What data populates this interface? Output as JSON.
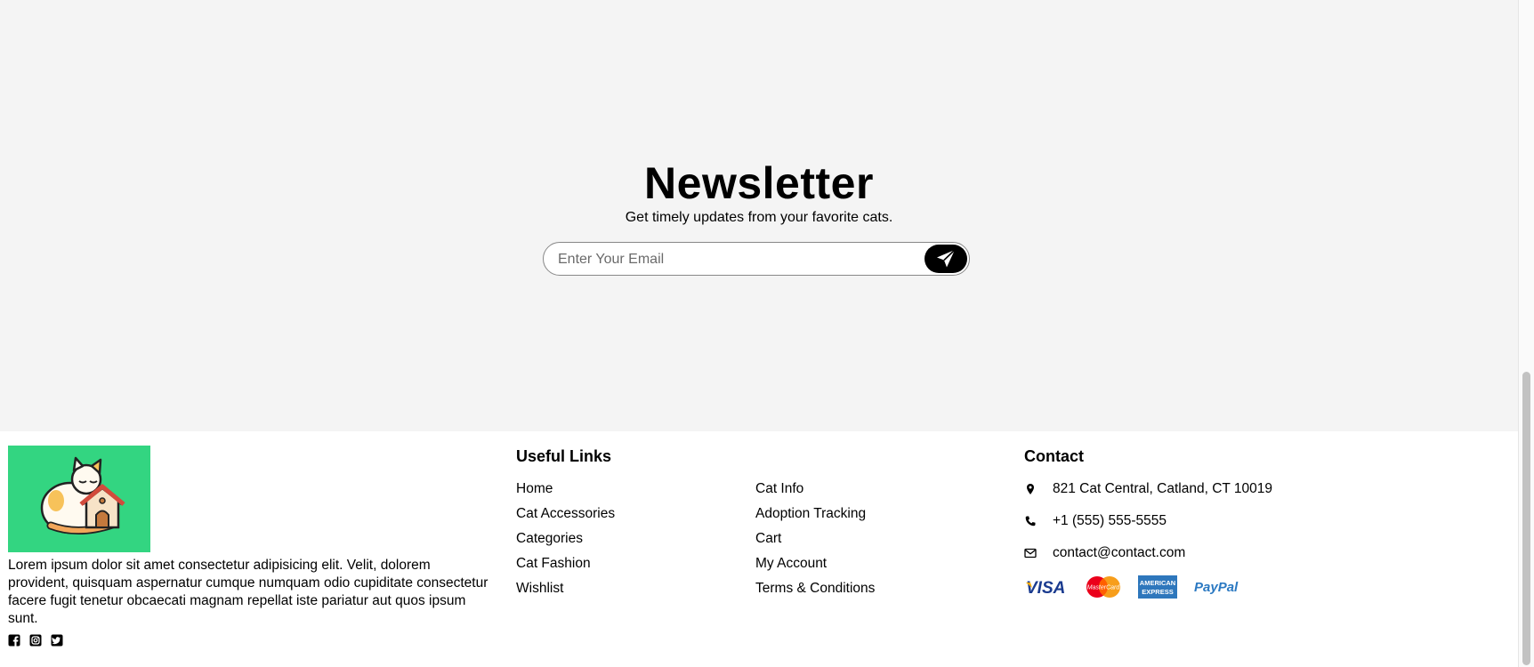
{
  "newsletter": {
    "title": "Newsletter",
    "subtitle": "Get timely updates from your favorite cats.",
    "email_placeholder": "Enter Your Email",
    "email_value": "",
    "submit_icon": "send-icon"
  },
  "footer": {
    "about": "Lorem ipsum dolor sit amet consectetur adipisicing elit. Velit, dolorem provident, quisquam aspernatur cumque numquam odio cupiditate consectetur facere fugit tenetur obcaecati magnam repellat iste pariatur aut quos ipsum sunt.",
    "logo_icon": "cat-house-logo",
    "socials": [
      "facebook-icon",
      "instagram-icon",
      "twitter-icon"
    ],
    "useful_links": {
      "title": "Useful Links",
      "column1": [
        "Home",
        "Cat Accessories",
        "Categories",
        "Cat Fashion",
        "Wishlist"
      ],
      "column2": [
        "Cat Info",
        "Adoption Tracking",
        "Cart",
        "My Account",
        "Terms & Conditions"
      ]
    },
    "contact": {
      "title": "Contact",
      "address": "821 Cat Central, Catland, CT 10019",
      "phone": "+1 (555) 555-5555",
      "email": "contact@contact.com"
    },
    "payments": {
      "visa": "VISA",
      "mastercard": "MasterCard",
      "amex_line1": "AMERICAN",
      "amex_line2": "EXPRESS",
      "paypal": "PayPal"
    }
  },
  "colors": {
    "newsletter_bg": "#f4f4f4",
    "logo_bg": "#33d581",
    "button_bg": "#000000"
  }
}
